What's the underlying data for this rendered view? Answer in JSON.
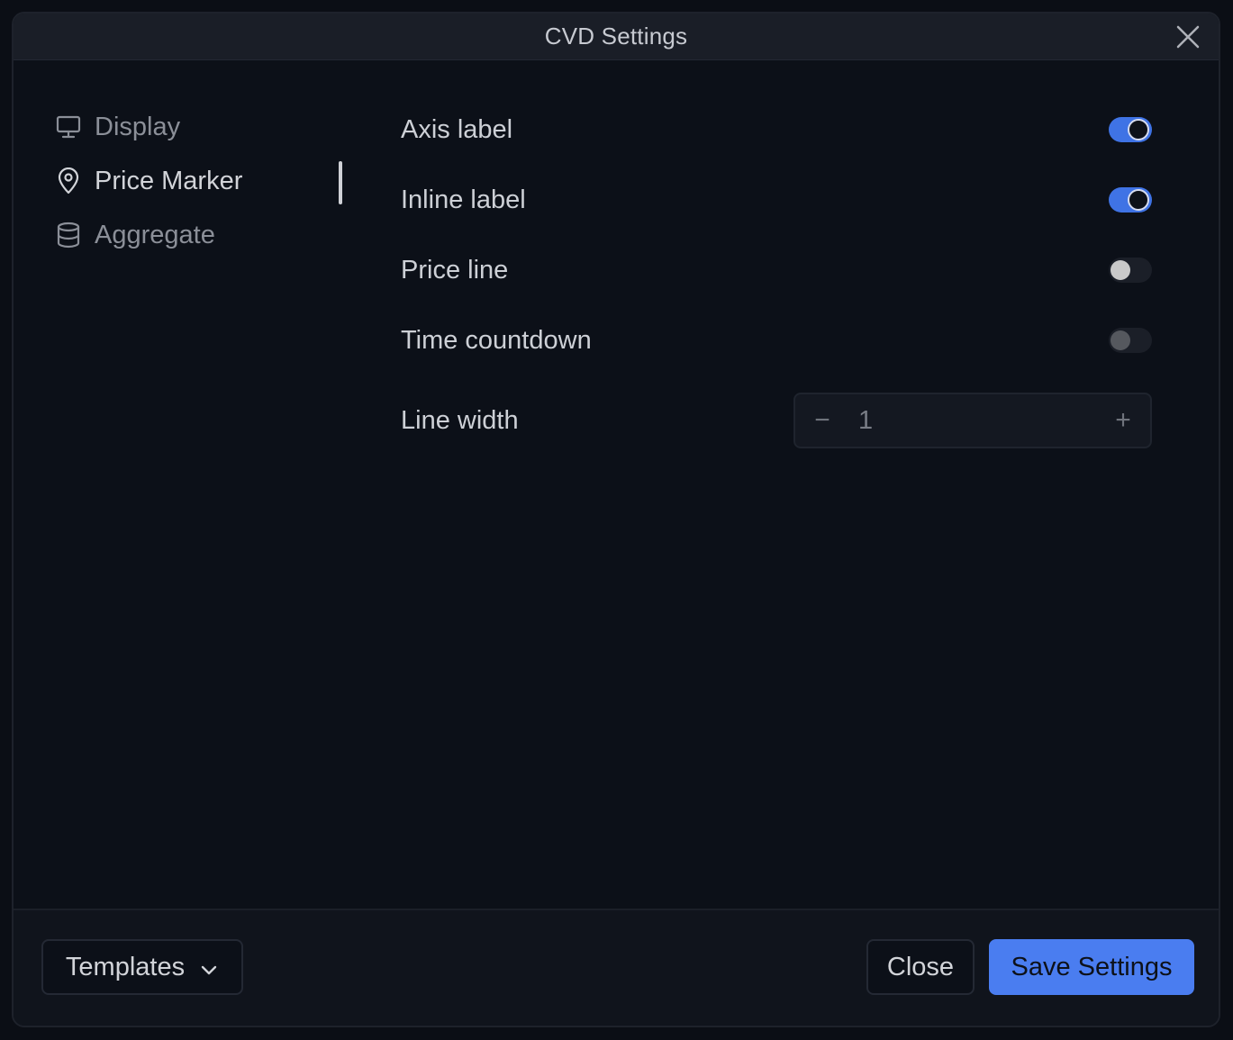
{
  "dialog": {
    "title": "CVD Settings"
  },
  "nav": {
    "items": [
      {
        "label": "Display",
        "icon": "monitor-icon",
        "active": false
      },
      {
        "label": "Price Marker",
        "icon": "map-pin-icon",
        "active": true
      },
      {
        "label": "Aggregate",
        "icon": "database-icon",
        "active": false
      }
    ]
  },
  "settings": {
    "axis_label": {
      "label": "Axis label",
      "enabled": true
    },
    "inline_label": {
      "label": "Inline label",
      "enabled": true
    },
    "price_line": {
      "label": "Price line",
      "enabled": false
    },
    "time_countdown": {
      "label": "Time countdown",
      "enabled": false
    },
    "line_width": {
      "label": "Line width",
      "value": "1",
      "decrement": "−",
      "increment": "+"
    }
  },
  "footer": {
    "templates_label": "Templates",
    "close_label": "Close",
    "save_label": "Save Settings"
  },
  "colors": {
    "accent": "#4a7df0",
    "background": "#0c1018",
    "panel": "#1a1e27"
  }
}
